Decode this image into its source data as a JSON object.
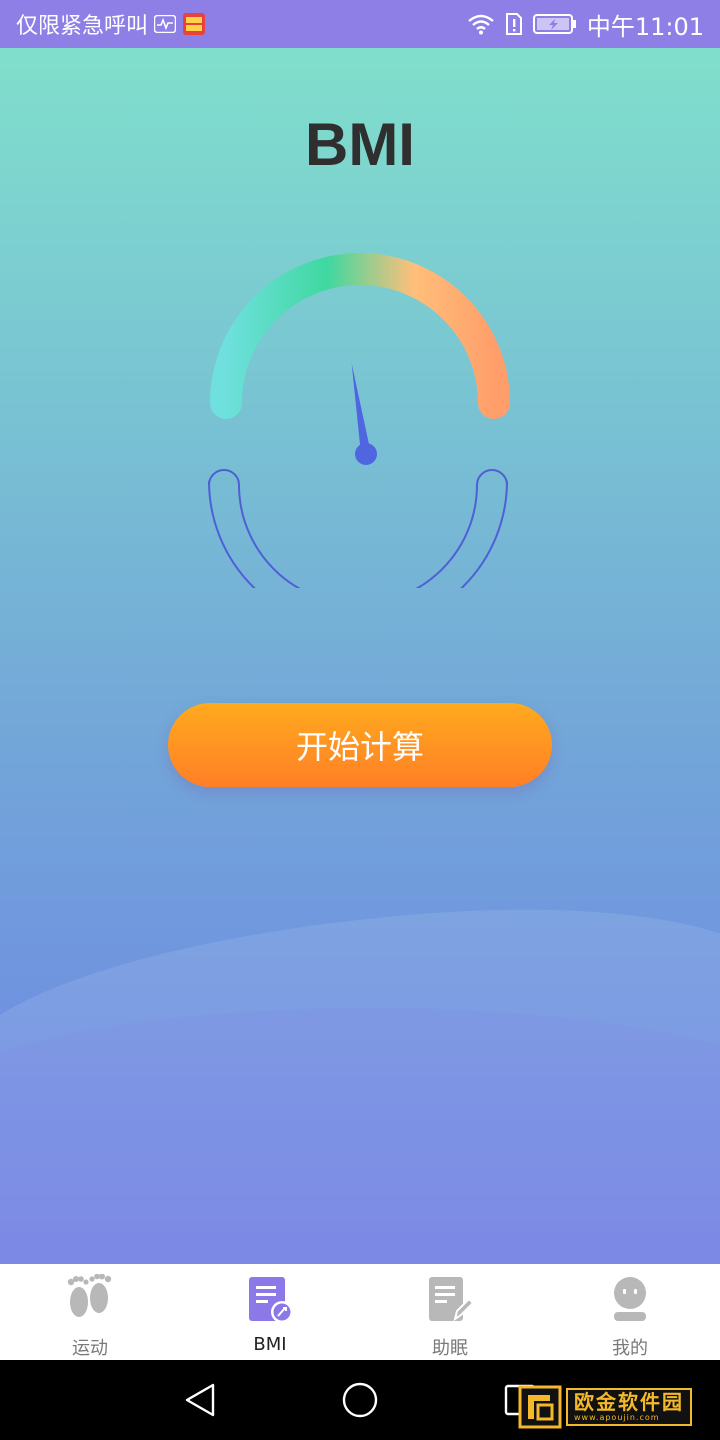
{
  "status_bar": {
    "left_text": "仅限紧急呼叫",
    "time": "中午11:01",
    "icons": [
      "activity-icon",
      "news-app-icon",
      "wifi-icon",
      "sim-alert-icon",
      "battery-charging-icon"
    ]
  },
  "page": {
    "title": "BMI"
  },
  "gauge": {
    "needle_level": 0.45,
    "colors": [
      "#6fe0dd",
      "#3fd8a0",
      "#ffbf7a",
      "#ff9e6a"
    ],
    "ring_color": "#4f5fd6",
    "needle_color": "#4f66e0"
  },
  "start_button": {
    "label": "开始计算"
  },
  "tabs": [
    {
      "label": "运动",
      "icon": "footprints-icon",
      "active": false
    },
    {
      "label": "BMI",
      "icon": "bmi-document-icon",
      "active": true
    },
    {
      "label": "助眠",
      "icon": "sleep-note-icon",
      "active": false
    },
    {
      "label": "我的",
      "icon": "profile-icon",
      "active": false
    }
  ],
  "nav_bar": {
    "icons": [
      "back-icon",
      "home-icon",
      "recents-icon"
    ]
  },
  "watermark": {
    "text": "欧金软件园",
    "sub": "www.apoujin.com"
  },
  "colors": {
    "status_bar": "#8e7fe6",
    "accent": "#8d78e8",
    "button_top": "#ffaa1e",
    "button_bottom": "#ff7f26"
  }
}
